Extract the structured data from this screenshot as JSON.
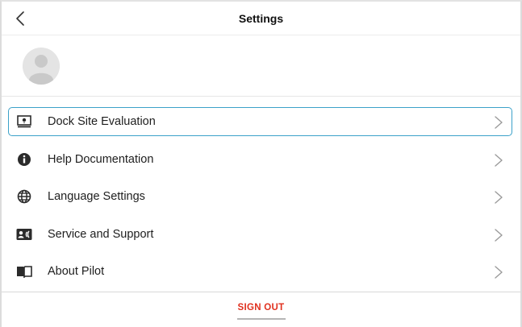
{
  "header": {
    "title": "Settings",
    "back_icon": "chevron-left-icon"
  },
  "profile": {
    "avatar_icon": "person-avatar-icon"
  },
  "menu": {
    "items": [
      {
        "label": "Dock Site Evaluation",
        "icon": "dock-evaluation-icon",
        "selected": true
      },
      {
        "label": "Help Documentation",
        "icon": "info-icon",
        "selected": false
      },
      {
        "label": "Language Settings",
        "icon": "globe-icon",
        "selected": false
      },
      {
        "label": "Service and Support",
        "icon": "contact-card-icon",
        "selected": false
      },
      {
        "label": "About Pilot",
        "icon": "book-icon",
        "selected": false
      }
    ]
  },
  "footer": {
    "sign_out_label": "SIGN OUT"
  },
  "colors": {
    "accent_border": "#3ba1c9",
    "sign_out": "#e0301e",
    "icon": "#2b2b2b",
    "chevron": "#9a9a9a"
  }
}
